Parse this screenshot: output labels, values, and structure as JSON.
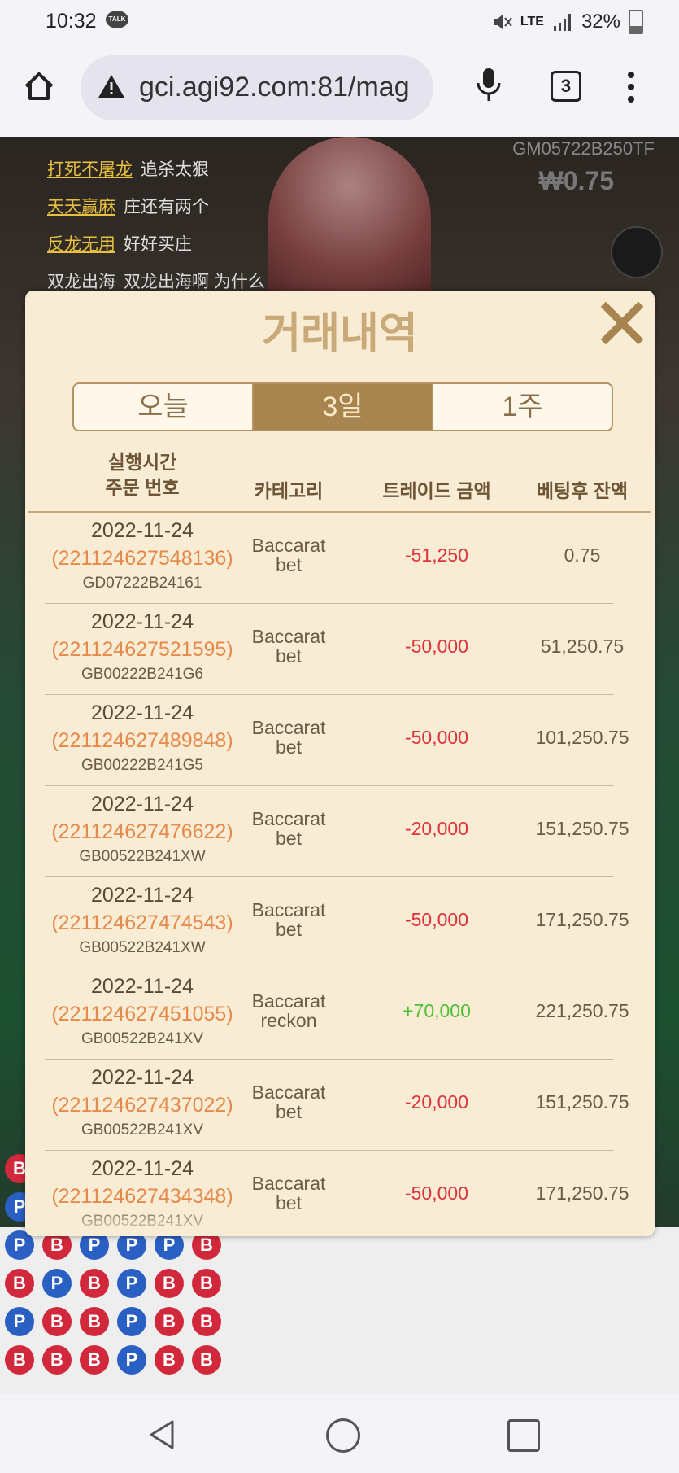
{
  "status": {
    "time": "10:32",
    "talk": "TALK",
    "network": "LTE",
    "battery": "32%"
  },
  "browser": {
    "url": "gci.agi92.com:81/mag",
    "tab_count": "3"
  },
  "game": {
    "chat": [
      {
        "nick": "打死不屠龙",
        "msg": "追杀太狠"
      },
      {
        "nick": "天天赢麻",
        "msg": "庄还有两个"
      },
      {
        "nick": "反龙无用",
        "msg": "好好买庄"
      },
      {
        "nick": "双龙出海",
        "msg": "双龙出海啊 为什么"
      }
    ],
    "table_id": "GM05722B250TF",
    "balance": "₩0.75",
    "bead_road": [
      [
        "B",
        "P",
        "B",
        "P",
        "B",
        "B"
      ],
      [
        "P",
        "B",
        "P",
        "P",
        "P",
        "P"
      ],
      [
        "P",
        "B",
        "P",
        "P",
        "P",
        "B"
      ],
      [
        "B",
        "P",
        "B",
        "P",
        "B",
        "B"
      ],
      [
        "P",
        "B",
        "B",
        "P",
        "B",
        "B"
      ],
      [
        "B",
        "B",
        "B",
        "P",
        "B",
        "B"
      ]
    ]
  },
  "modal": {
    "title": "거래내역",
    "tabs": [
      "오늘",
      "3일",
      "1주"
    ],
    "active_tab": 1,
    "headers": {
      "time": "실행시간",
      "order": "주문 번호",
      "category": "카테고리",
      "amount": "트레이드 금액",
      "balance": "베팅후 잔액"
    },
    "rows": [
      {
        "date": "2022-11-24",
        "order": "(221124627548136)",
        "game": "GD07222B24161",
        "cat1": "Baccarat",
        "cat2": "bet",
        "amount": "-51,250",
        "balance": "0.75"
      },
      {
        "date": "2022-11-24",
        "order": "(221124627521595)",
        "game": "GB00222B241G6",
        "cat1": "Baccarat",
        "cat2": "bet",
        "amount": "-50,000",
        "balance": "51,250.75"
      },
      {
        "date": "2022-11-24",
        "order": "(221124627489848)",
        "game": "GB00222B241G5",
        "cat1": "Baccarat",
        "cat2": "bet",
        "amount": "-50,000",
        "balance": "101,250.75"
      },
      {
        "date": "2022-11-24",
        "order": "(221124627476622)",
        "game": "GB00522B241XW",
        "cat1": "Baccarat",
        "cat2": "bet",
        "amount": "-20,000",
        "balance": "151,250.75"
      },
      {
        "date": "2022-11-24",
        "order": "(221124627474543)",
        "game": "GB00522B241XW",
        "cat1": "Baccarat",
        "cat2": "bet",
        "amount": "-50,000",
        "balance": "171,250.75"
      },
      {
        "date": "2022-11-24",
        "order": "(221124627451055)",
        "game": "GB00522B241XV",
        "cat1": "Baccarat",
        "cat2": "reckon",
        "amount": "+70,000",
        "balance": "221,250.75"
      },
      {
        "date": "2022-11-24",
        "order": "(221124627437022)",
        "game": "GB00522B241XV",
        "cat1": "Baccarat",
        "cat2": "bet",
        "amount": "-20,000",
        "balance": "151,250.75"
      },
      {
        "date": "2022-11-24",
        "order": "(221124627434348)",
        "game": "GB00522B241XV",
        "cat1": "Baccarat",
        "cat2": "bet",
        "amount": "-50,000",
        "balance": "171,250.75"
      }
    ]
  }
}
